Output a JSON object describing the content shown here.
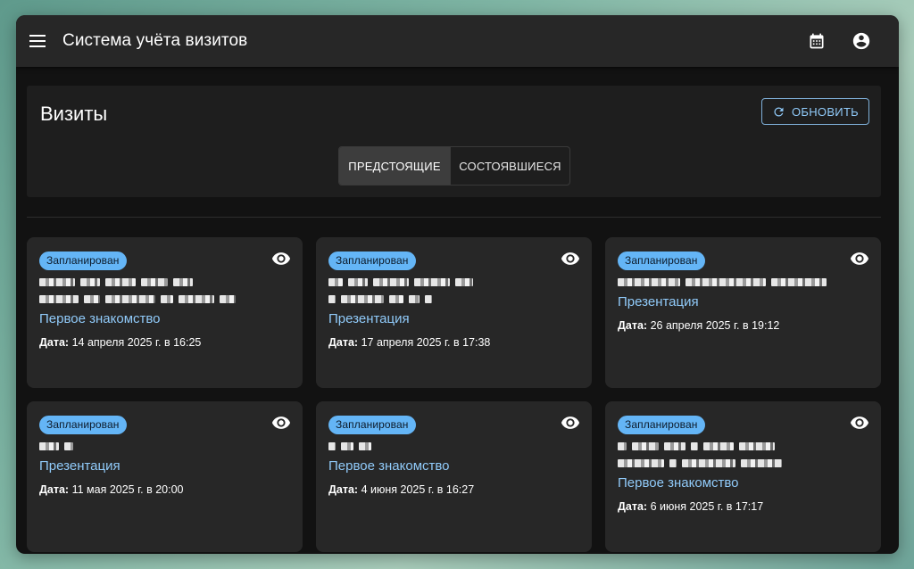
{
  "app": {
    "title": "Система учёта визитов"
  },
  "panel": {
    "title": "Визиты",
    "refresh_label": "ОБНОВИТЬ",
    "tabs": [
      {
        "label": "ПРЕДСТОЯЩИЕ",
        "active": true
      },
      {
        "label": "СОСТОЯВШИЕСЯ",
        "active": false
      }
    ]
  },
  "icons": {
    "menu": "menu-icon",
    "calendar": "calendar-icon",
    "account": "account-circle-icon",
    "refresh": "refresh-icon",
    "view": "eye-icon"
  },
  "colors": {
    "accent": "#90caf9",
    "badge": "#64b5f6",
    "appbar": "#272727",
    "card": "#272727",
    "background": "#121212"
  },
  "date_label": "Дата:",
  "visits": [
    {
      "status": "Запланирован",
      "type": "Первое знакомство",
      "date": "14 апреля 2025 г. в 16:25"
    },
    {
      "status": "Запланирован",
      "type": "Презентация",
      "date": "17 апреля 2025 г. в 17:38"
    },
    {
      "status": "Запланирован",
      "type": "Презентация",
      "date": "26 апреля 2025 г. в 19:12"
    },
    {
      "status": "Запланирован",
      "type": "Презентация",
      "date": "11 мая 2025 г. в 20:00"
    },
    {
      "status": "Запланирован",
      "type": "Первое знакомство",
      "date": "4 июня 2025 г. в 16:27"
    },
    {
      "status": "Запланирован",
      "type": "Первое знакомство",
      "date": "6 июня 2025 г. в 17:17"
    }
  ]
}
